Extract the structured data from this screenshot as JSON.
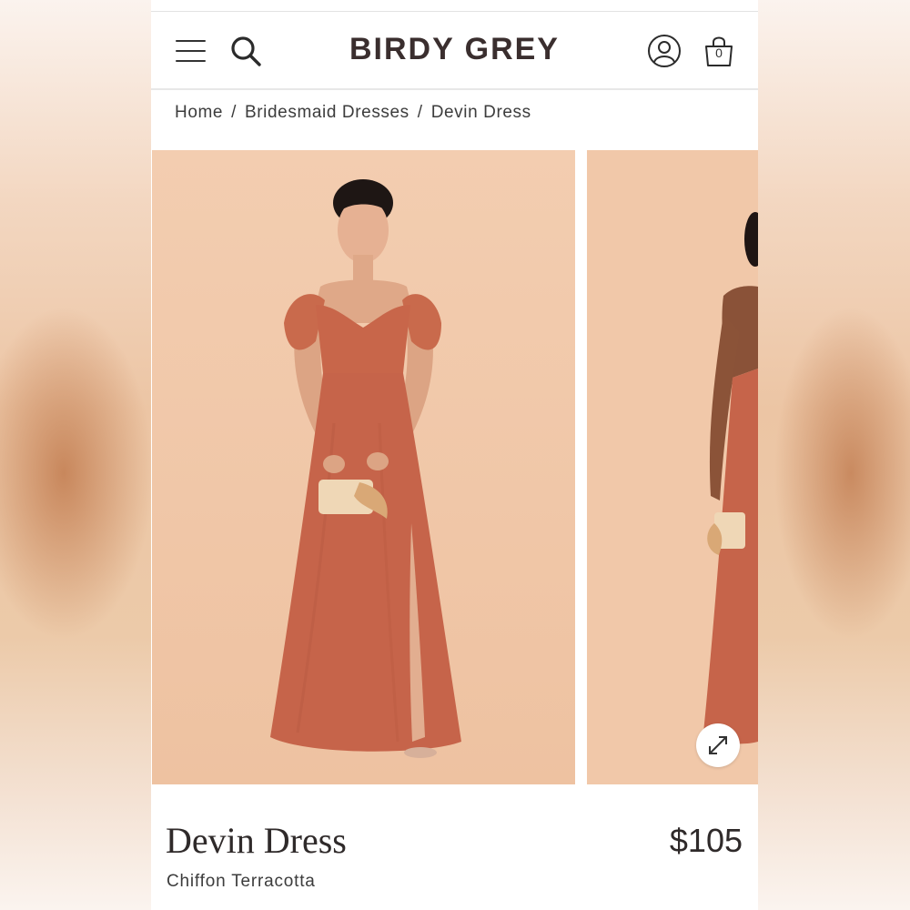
{
  "brand": {
    "name": "BIRDY GREY"
  },
  "header": {
    "icons": [
      "menu-icon",
      "search-icon",
      "account-icon",
      "bag-icon"
    ],
    "bag_count": "0"
  },
  "breadcrumb": {
    "items": [
      "Home",
      "Bridesmaid Dresses",
      "Devin Dress"
    ],
    "separator": "/"
  },
  "gallery": {
    "images": [
      "model-front-photo",
      "model-side-photo"
    ],
    "expand_icon": "expand-arrows-icon"
  },
  "product": {
    "title": "Devin Dress",
    "variant": "Chiffon Terracotta",
    "price": "$105"
  },
  "colors": {
    "brand_text": "#3a2e2e",
    "dress": "#c9674a",
    "photo_background": "#f0c6a6"
  }
}
